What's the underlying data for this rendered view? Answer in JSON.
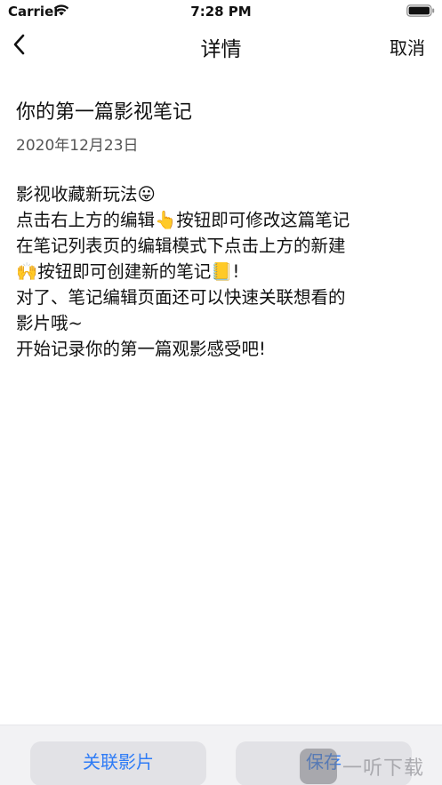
{
  "status_bar": {
    "carrier": "Carrier",
    "time": "7:28 PM"
  },
  "nav": {
    "title": "详情",
    "cancel_label": "取消"
  },
  "note": {
    "title": "你的第一篇影视笔记",
    "date": "2020年12月23日",
    "lines": [
      "影视收藏新玩法😛",
      "点击右上方的编辑👆按钮即可修改这篇笔记",
      "在笔记列表页的编辑模式下点击上方的新建",
      "🙌按钮即可创建新的笔记📒!",
      "对了、笔记编辑页面还可以快速关联想看的",
      "影片哦~",
      "开始记录你的第一篇观影感受吧!"
    ]
  },
  "bottom_bar": {
    "link_label": "关联影片",
    "save_label": "保存"
  },
  "watermark": {
    "text": "一听下载"
  },
  "colors": {
    "accent": "#2f7cf6",
    "bar_bg": "#f2f2f4",
    "button_bg": "#e2e2e6"
  }
}
